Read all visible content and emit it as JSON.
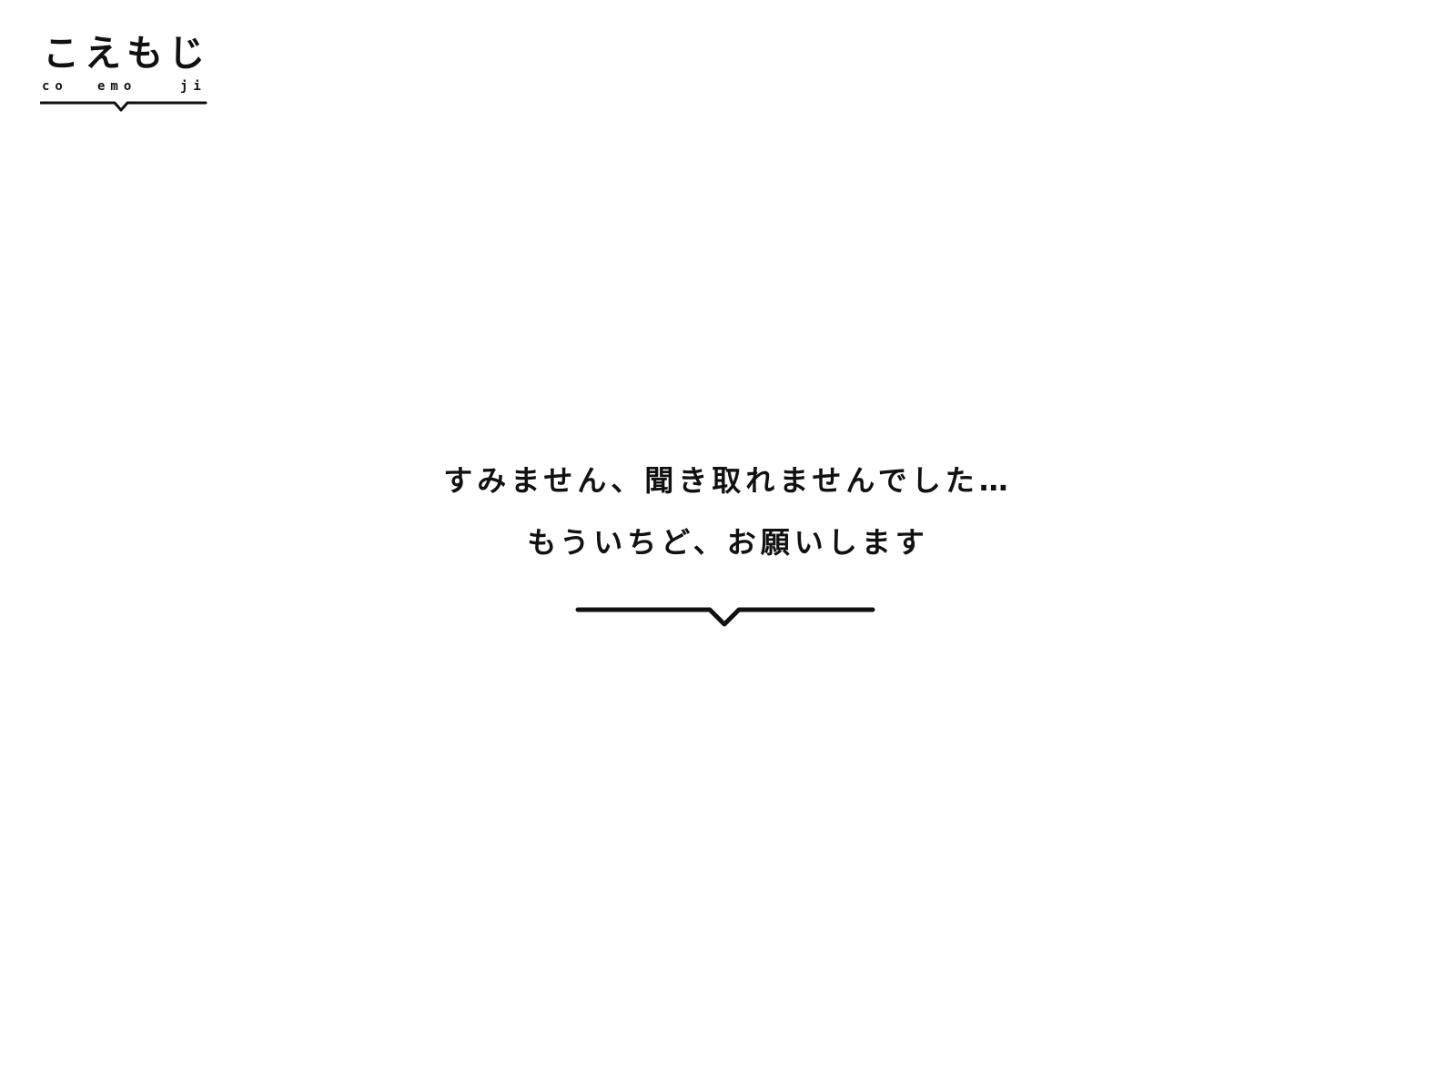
{
  "logo": {
    "main": [
      "こ",
      "え",
      "も",
      "じ"
    ],
    "sub": [
      "co",
      "emo",
      "ji"
    ]
  },
  "message": {
    "line1": "すみません、聞き取れませんでした…",
    "line2": "もういちど、お願いします"
  },
  "colors": {
    "text": "#111111",
    "background": "#ffffff"
  }
}
